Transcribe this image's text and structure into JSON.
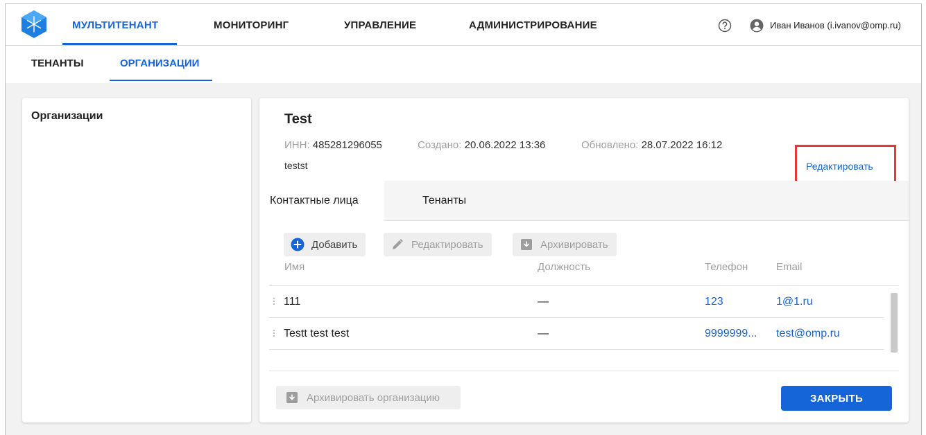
{
  "nav": {
    "items": [
      {
        "label": "МУЛЬТИТЕНАНТ",
        "active": true
      },
      {
        "label": "МОНИТОРИНГ",
        "active": false
      },
      {
        "label": "УПРАВЛЕНИЕ",
        "active": false
      },
      {
        "label": "АДМИНИСТРИРОВАНИЕ",
        "active": false
      }
    ],
    "user": "Иван Иванов (i.ivanov@omp.ru)"
  },
  "subtabs": [
    {
      "label": "ТЕНАНТЫ",
      "active": false
    },
    {
      "label": "ОРГАНИЗАЦИИ",
      "active": true
    }
  ],
  "left_panel": {
    "title": "Организации"
  },
  "org": {
    "name": "Test",
    "inn_label": "ИНН:",
    "inn_value": "485281296055",
    "created_label": "Создано:",
    "created_value": "20.06.2022 13:36",
    "updated_label": "Обновлено:",
    "updated_value": "28.07.2022 16:12",
    "description": "testst",
    "edit_label": "Редактировать"
  },
  "detail_tabs": [
    {
      "label": "Контактные лица",
      "active": true
    },
    {
      "label": "Тенанты",
      "active": false
    }
  ],
  "toolbar": {
    "add_label": "Добавить",
    "edit_label": "Редактировать",
    "archive_label": "Архивировать"
  },
  "table": {
    "columns": [
      "Имя",
      "Должность",
      "Телефон",
      "Email"
    ],
    "rows": [
      {
        "name": "111",
        "position": "—",
        "phone": "123",
        "email": "1@1.ru"
      },
      {
        "name": "Testt test test",
        "position": "—",
        "phone": "9999999...",
        "email": "test@omp.ru"
      }
    ]
  },
  "footer": {
    "archive_org_label": "Архивировать организацию",
    "close_label": "ЗАКРЫТЬ"
  },
  "colors": {
    "accent": "#1565d8",
    "highlight": "#e53935"
  }
}
